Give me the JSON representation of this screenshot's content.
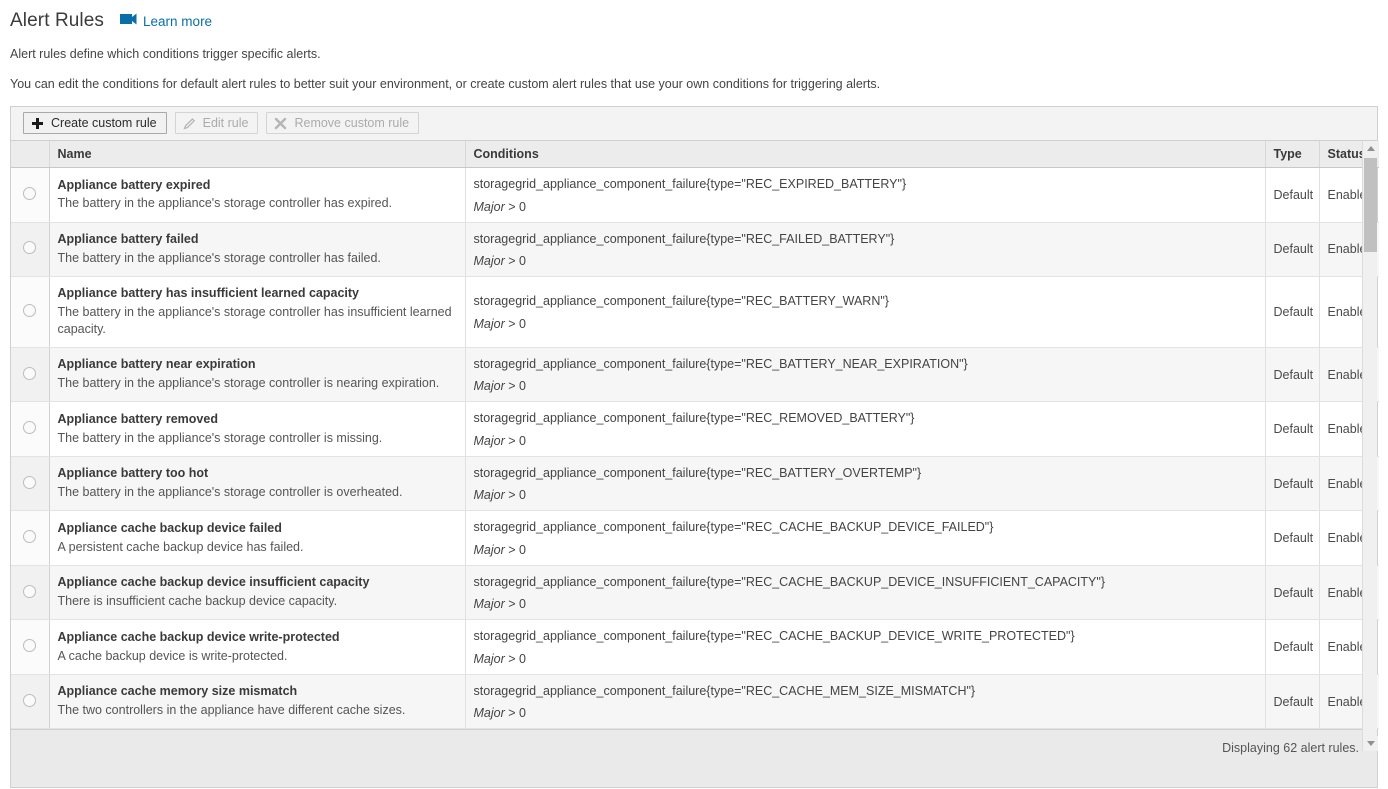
{
  "header": {
    "title": "Alert Rules",
    "learn_more_label": "Learn more",
    "learn_more_icon": "video-camera-icon",
    "intro_line_1": "Alert rules define which conditions trigger specific alerts.",
    "intro_line_2": "You can edit the conditions for default alert rules to better suit your environment, or create custom alert rules that use your own conditions for triggering alerts."
  },
  "colors": {
    "link": "#0a6fa8",
    "video_icon": "#0a6fa8",
    "header_bg": "#ececec",
    "alt_row_bg": "#f6f6f6",
    "toolbar_bg": "#f3f3f3",
    "footer_bg": "#eaeaea"
  },
  "toolbar": {
    "create_label": "Create custom rule",
    "create_icon": "plus-icon",
    "create_enabled": true,
    "edit_label": "Edit rule",
    "edit_icon": "pencil-icon",
    "edit_enabled": false,
    "remove_label": "Remove custom rule",
    "remove_icon": "close-x-icon",
    "remove_enabled": false
  },
  "table": {
    "columns": [
      "",
      "Name",
      "Conditions",
      "Type",
      "Status"
    ],
    "rows": [
      {
        "name": "Appliance battery expired",
        "description": "The battery in the appliance's storage controller has expired.",
        "condition": "storagegrid_appliance_component_failure{type=\"REC_EXPIRED_BATTERY\"}",
        "severity": "Major",
        "operator": "> 0",
        "type": "Default",
        "status": "Enabled"
      },
      {
        "name": "Appliance battery failed",
        "description": "The battery in the appliance's storage controller has failed.",
        "condition": "storagegrid_appliance_component_failure{type=\"REC_FAILED_BATTERY\"}",
        "severity": "Major",
        "operator": "> 0",
        "type": "Default",
        "status": "Enabled"
      },
      {
        "name": "Appliance battery has insufficient learned capacity",
        "description": "The battery in the appliance's storage controller has insufficient learned capacity.",
        "condition": "storagegrid_appliance_component_failure{type=\"REC_BATTERY_WARN\"}",
        "severity": "Major",
        "operator": "> 0",
        "type": "Default",
        "status": "Enabled"
      },
      {
        "name": "Appliance battery near expiration",
        "description": "The battery in the appliance's storage controller is nearing expiration.",
        "condition": "storagegrid_appliance_component_failure{type=\"REC_BATTERY_NEAR_EXPIRATION\"}",
        "severity": "Major",
        "operator": "> 0",
        "type": "Default",
        "status": "Enabled"
      },
      {
        "name": "Appliance battery removed",
        "description": "The battery in the appliance's storage controller is missing.",
        "condition": "storagegrid_appliance_component_failure{type=\"REC_REMOVED_BATTERY\"}",
        "severity": "Major",
        "operator": "> 0",
        "type": "Default",
        "status": "Enabled"
      },
      {
        "name": "Appliance battery too hot",
        "description": "The battery in the appliance's storage controller is overheated.",
        "condition": "storagegrid_appliance_component_failure{type=\"REC_BATTERY_OVERTEMP\"}",
        "severity": "Major",
        "operator": "> 0",
        "type": "Default",
        "status": "Enabled"
      },
      {
        "name": "Appliance cache backup device failed",
        "description": "A persistent cache backup device has failed.",
        "condition": "storagegrid_appliance_component_failure{type=\"REC_CACHE_BACKUP_DEVICE_FAILED\"}",
        "severity": "Major",
        "operator": "> 0",
        "type": "Default",
        "status": "Enabled"
      },
      {
        "name": "Appliance cache backup device insufficient capacity",
        "description": "There is insufficient cache backup device capacity.",
        "condition": "storagegrid_appliance_component_failure{type=\"REC_CACHE_BACKUP_DEVICE_INSUFFICIENT_CAPACITY\"}",
        "severity": "Major",
        "operator": "> 0",
        "type": "Default",
        "status": "Enabled"
      },
      {
        "name": "Appliance cache backup device write-protected",
        "description": "A cache backup device is write-protected.",
        "condition": "storagegrid_appliance_component_failure{type=\"REC_CACHE_BACKUP_DEVICE_WRITE_PROTECTED\"}",
        "severity": "Major",
        "operator": "> 0",
        "type": "Default",
        "status": "Enabled"
      },
      {
        "name": "Appliance cache memory size mismatch",
        "description": "The two controllers in the appliance have different cache sizes.",
        "condition": "storagegrid_appliance_component_failure{type=\"REC_CACHE_MEM_SIZE_MISMATCH\"}",
        "severity": "Major",
        "operator": "> 0",
        "type": "Default",
        "status": "Enabled"
      }
    ]
  },
  "footer": {
    "count_text": "Displaying 62 alert rules."
  },
  "scrollbar": {
    "up_icon": "triangle-up-icon",
    "down_icon": "triangle-down-icon"
  }
}
